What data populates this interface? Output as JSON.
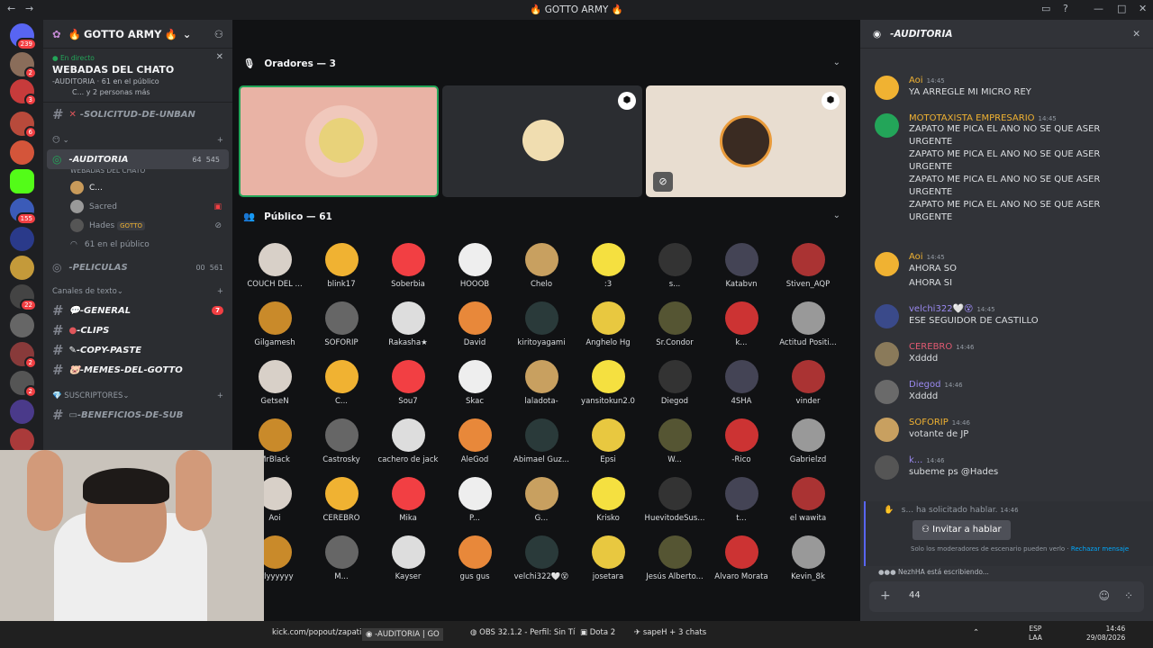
{
  "window": {
    "title": "GOTTO ARMY"
  },
  "server": {
    "name": "GOTTO ARMY",
    "live_label": "En directo",
    "event_title": "WEBADAS DEL CHATO",
    "event_channel": "-AUDITORIA",
    "event_public": "61 en el público",
    "event_people": "C... y 2 personas más"
  },
  "rail_badges": [
    "239",
    "2",
    "3",
    "6",
    "155",
    "22",
    "2",
    "2"
  ],
  "sidebar": {
    "ch_unban": "-SOLICITUD-DE-UNBAN",
    "stage_name": "-AUDITORIA",
    "stage_sub": "WEBADAS DEL CHATO",
    "stage_count_a": "64",
    "stage_count_b": "545",
    "members": [
      "C...",
      "Sacred",
      "Hades",
      "61 en el público"
    ],
    "hades_tag": "GOTTO",
    "peliculas": "-PELICULAS",
    "peliculas_a": "00",
    "peliculas_b": "561",
    "text_cat": "Canales de texto",
    "text_channels": [
      "-GENERAL",
      "-CLIPS",
      "-COPY-PASTE",
      "-MEMES-DEL-GOTTO"
    ],
    "general_badge": "7",
    "subs_cat": "SUSCRIPTORES",
    "subs_channel": "-BENEFICIOS-DE-SUB"
  },
  "stage": {
    "speakers_title": "Oradores — 3",
    "public_title": "Público — 61"
  },
  "audience": [
    "COUCH DEL ...",
    "blink17",
    "Soberbia",
    "HOOOB",
    "Chelo",
    ":3",
    "s...",
    "Katabvn",
    "Stiven_AQP",
    "Gilgamesh",
    "SOFORIP",
    "Rakasha★",
    "David",
    "kiritoyagami",
    "Anghelo Hg",
    "Sr.Condor",
    "k...",
    "Actitud Positi...",
    "GetseN",
    "C...",
    "Sou7",
    "Skac",
    "laladota-",
    "yansitokun2.0",
    "Diegod",
    "4SHA",
    "vinder",
    "MrBlack",
    "Castrosky",
    "cachero de jack",
    "AleGod",
    "Abimael Guz...",
    "Epsi",
    "W...",
    "-Rico",
    "Gabrielzd",
    "Aoi",
    "CEREBRO",
    "Mika",
    "P...",
    "G...",
    "Krisko",
    "HuevitodeSus...",
    "t...",
    "el wawita",
    "arlyyyyyy",
    "M...",
    "Kayser",
    "gus gus",
    "velchi322🤍😵",
    "josetara",
    "Jesús Alberto...",
    "Alvaro Morata",
    "Kevin_8k"
  ],
  "chat": {
    "channel": "-AUDITORIA",
    "messages": [
      {
        "name": "Aoi",
        "time": "14:45",
        "color": "#f0b232",
        "lines": [
          "YA ARREGLE MI MICRO REY"
        ]
      },
      {
        "name": "MOTOTAXISTA EMPRESARIO",
        "time": "14:45",
        "color": "#f0b232",
        "lines": [
          "ZAPATO ME PICA EL ANO NO SE QUE ASER URGENTE",
          "ZAPATO ME PICA EL ANO NO SE QUE ASER URGENTE",
          "ZAPATO ME PICA EL ANO NO SE QUE ASER URGENTE",
          "ZAPATO ME PICA EL ANO NO SE QUE ASER URGENTE"
        ]
      },
      {
        "name": "Aoi",
        "time": "14:45",
        "color": "#f0b232",
        "lines": [
          "AHORA SO",
          "AHORA SI"
        ]
      },
      {
        "name": "velchi322🤍😵",
        "time": "14:45",
        "color": "#9a89f0",
        "lines": [
          "ESE SEGUIDOR DE CASTILLO"
        ]
      },
      {
        "name": "CEREBRO",
        "time": "14:46",
        "color": "#e25a72",
        "lines": [
          "Xdddd"
        ]
      },
      {
        "name": "Diegod",
        "time": "14:46",
        "color": "#9a89f0",
        "lines": [
          "Xdddd"
        ]
      },
      {
        "name": "SOFORIP",
        "time": "14:46",
        "color": "#f0b232",
        "lines": [
          "votante de JP"
        ]
      },
      {
        "name": "k...",
        "time": "14:46",
        "color": "#9a89f0",
        "lines": [
          "subeme ps @Hades"
        ]
      }
    ],
    "request_name": "s...",
    "request_text": "ha solicitado hablar.",
    "request_time": "14:46",
    "invite_label": "Invitar a hablar",
    "mod_note": "Solo los moderadores de escenario pueden verlo",
    "reject_label": "Rechazar mensaje",
    "typing": "NezhHA está escribiendo...",
    "input_value": "44"
  },
  "taskbar": {
    "items": [
      "kick.com/popout/zapati",
      "-AUDITORIA | GO",
      "OBS 32.1.2 - Perfil: Sin Tí",
      "Dota 2",
      "sapeH + 3 chats"
    ],
    "lang": "ESP",
    "lang2": "LAA",
    "time": "14:46",
    "date": "29/08/2026"
  }
}
